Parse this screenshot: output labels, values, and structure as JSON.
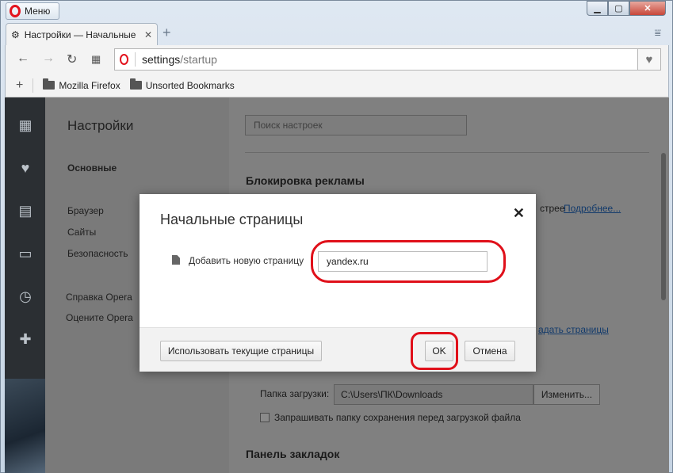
{
  "window": {
    "menu_label": "Меню",
    "controls": {
      "minimize": "▁",
      "maximize": "▢",
      "close": "✕"
    }
  },
  "tab": {
    "title": "Настройки — Начальные",
    "icon": "gear-icon",
    "close": "✕"
  },
  "toolbar": {
    "address_host": "settings",
    "address_path": "/startup"
  },
  "bookmarks": {
    "add": "+",
    "items": [
      {
        "label": "Mozilla Firefox",
        "icon": "folder-icon"
      },
      {
        "label": "Unsorted Bookmarks",
        "icon": "folder-icon"
      }
    ]
  },
  "settings_nav": {
    "title": "Настройки",
    "items": [
      "Основные",
      "Браузер",
      "Сайты",
      "Безопасность"
    ],
    "help": "Справка Opera",
    "rate": "Оцените Opera"
  },
  "settings_main": {
    "search_placeholder": "Поиск настроек",
    "ad_block_title": "Блокировка рекламы",
    "ad_block_text": "стрее",
    "ad_block_link": "Подробнее...",
    "set_pages_link": "адать страницы",
    "download_label": "Папка загрузки:",
    "download_path": "C:\\Users\\ПК\\Downloads",
    "change_button": "Изменить...",
    "ask_save_label": "Запрашивать папку сохранения перед загрузкой файла",
    "bookmarks_panel_title": "Панель закладок"
  },
  "dialog": {
    "title": "Начальные страницы",
    "add_page_label": "Добавить новую страницу",
    "url_value": "yandex.ru",
    "use_current_button": "Использовать текущие страницы",
    "ok_button": "OK",
    "cancel_button": "Отмена"
  },
  "colors": {
    "highlight": "#e0101a",
    "opera_red": "#e3141e"
  }
}
